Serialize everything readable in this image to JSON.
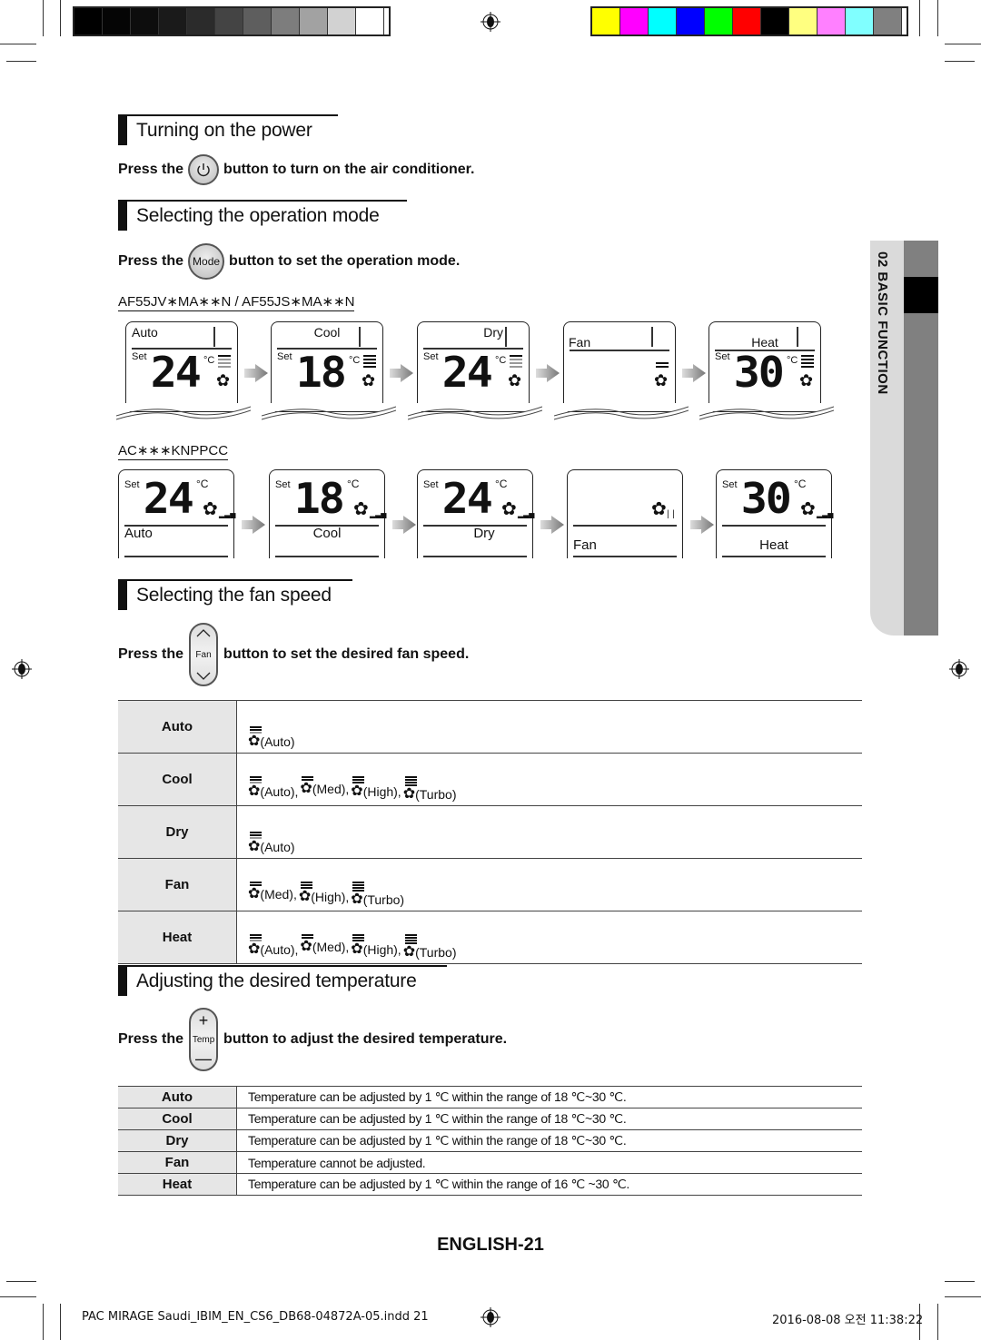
{
  "print_marks": {
    "grayscale": [
      "#000000",
      "#050505",
      "#0d0d0d",
      "#1a1a1a",
      "#2b2b2b",
      "#444444",
      "#5e5e5e",
      "#7d7d7d",
      "#a2a2a2",
      "#d2d2d2",
      "#ffffff"
    ],
    "colors": [
      "#ffff00",
      "#ff00ff",
      "#00ffff",
      "#0000ff",
      "#00ff00",
      "#ff0000",
      "#000000",
      "#ffff80",
      "#ff80ff",
      "#80ffff",
      "#808080"
    ]
  },
  "side_tab": {
    "label": "02  BASIC FUNCTION"
  },
  "power": {
    "title": "Turning on the power",
    "press_the": "Press the",
    "after_button": "button to turn on the air conditioner.",
    "button_icon": "power-icon"
  },
  "mode": {
    "title": "Selecting the operation mode",
    "press_the": "Press the",
    "button_label": "Mode",
    "after_button": "button to set the operation mode.",
    "model_a": "AF55JV∗MA∗∗N / AF55JS∗MA∗∗N",
    "model_b": "AC∗∗∗KNPPCC",
    "set_label": "Set",
    "deg_label": "°C",
    "displays_a": [
      {
        "mode": "Auto",
        "temp": "24"
      },
      {
        "mode": "Cool",
        "temp": "18"
      },
      {
        "mode": "Dry",
        "temp": "24"
      },
      {
        "mode": "Fan",
        "temp": ""
      },
      {
        "mode": "Heat",
        "temp": "30"
      }
    ],
    "displays_b": [
      {
        "mode": "Auto",
        "temp": "24"
      },
      {
        "mode": "Cool",
        "temp": "18"
      },
      {
        "mode": "Dry",
        "temp": "24"
      },
      {
        "mode": "Fan",
        "temp": ""
      },
      {
        "mode": "Heat",
        "temp": "30"
      }
    ]
  },
  "fan": {
    "title": "Selecting the fan speed",
    "press_the": "Press the",
    "button_label": "Fan",
    "after_button": "button to set the desired fan speed.",
    "rows": [
      {
        "mode": "Auto",
        "speeds": [
          "(Auto)"
        ]
      },
      {
        "mode": "Cool",
        "speeds": [
          "(Auto),",
          "(Med),",
          "(High),",
          "(Turbo)"
        ]
      },
      {
        "mode": "Dry",
        "speeds": [
          "(Auto)"
        ]
      },
      {
        "mode": "Fan",
        "speeds": [
          "(Med),",
          "(High),",
          "(Turbo)"
        ]
      },
      {
        "mode": "Heat",
        "speeds": [
          "(Auto),",
          "(Med),",
          "(High),",
          "(Turbo)"
        ]
      }
    ]
  },
  "temp": {
    "title": "Adjusting the desired temperature",
    "press_the": "Press the",
    "button_label": "Temp",
    "plus": "+",
    "minus": "—",
    "after_button": "button to adjust the desired temperature.",
    "rows": [
      {
        "mode": "Auto",
        "text": "Temperature can be adjusted by 1 ℃ within the range of 18 ℃~30 ℃."
      },
      {
        "mode": "Cool",
        "text": "Temperature can be adjusted by 1 ℃ within the range of 18 ℃~30 ℃."
      },
      {
        "mode": "Dry",
        "text": "Temperature can be adjusted by 1 ℃ within the range of 18 ℃~30 ℃."
      },
      {
        "mode": "Fan",
        "text": "Temperature cannot be adjusted."
      },
      {
        "mode": "Heat",
        "text": "Temperature can be adjusted by 1 ℃ within the range of 16 ℃ ~30 ℃."
      }
    ]
  },
  "page_number": "ENGLISH-21",
  "footer": {
    "file": "PAC MIRAGE Saudi_IBIM_EN_CS6_DB68-04872A-05.indd   21",
    "timestamp": "2016-08-08   오전 11:38:22"
  }
}
